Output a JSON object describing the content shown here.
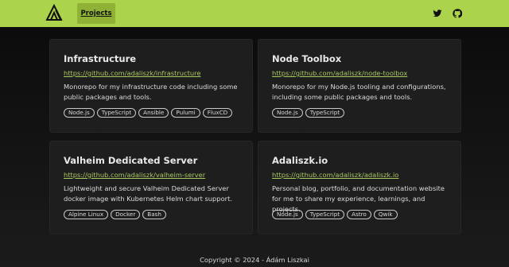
{
  "header": {
    "logo_icon": "triangle-a-logo-icon",
    "nav": [
      {
        "label": "Projects"
      }
    ],
    "social": [
      {
        "name": "twitter-icon"
      },
      {
        "name": "github-icon"
      }
    ],
    "colors": {
      "header_bg": "#abd34b",
      "active_nav_bg": "#8fb236"
    }
  },
  "projects": [
    {
      "title": "Infrastructure",
      "link": "https://github.com/adaliszk/infrastructure",
      "description": "Monorepo for my infrastructure code including some public packages and tools.",
      "tags": [
        "Node.js",
        "TypeScript",
        "Ansible",
        "Pulumi",
        "FluxCD"
      ]
    },
    {
      "title": "Node Toolbox",
      "link": "https://github.com/adaliszk/node-toolbox",
      "description": "Monorepo for my Node.js tooling and configurations, including some public packages and tools.",
      "tags": [
        "Node.js",
        "TypeScript"
      ]
    },
    {
      "title": "Valheim Dedicated Server",
      "link": "https://github.com/adaliszk/valheim-server",
      "description": "Lightweight and secure Valheim Dedicated Server docker image with Kubernetes Helm chart support.",
      "tags": [
        "Alpine Linux",
        "Docker",
        "Bash"
      ]
    },
    {
      "title": "Adaliszk.io",
      "link": "https://github.com/adaliszk/adaliszk.io",
      "description": "Personal blog, portfolio, and documentation website for me to share my experience, learnings, and projects.",
      "tags": [
        "Node.js",
        "TypeScript",
        "Astro",
        "Qwik"
      ]
    }
  ],
  "footer": {
    "text": "Copyright © 2024 - Ádám Liszkai"
  },
  "colors": {
    "link": "#a8c862",
    "card_bg": "#1e1e1e"
  }
}
